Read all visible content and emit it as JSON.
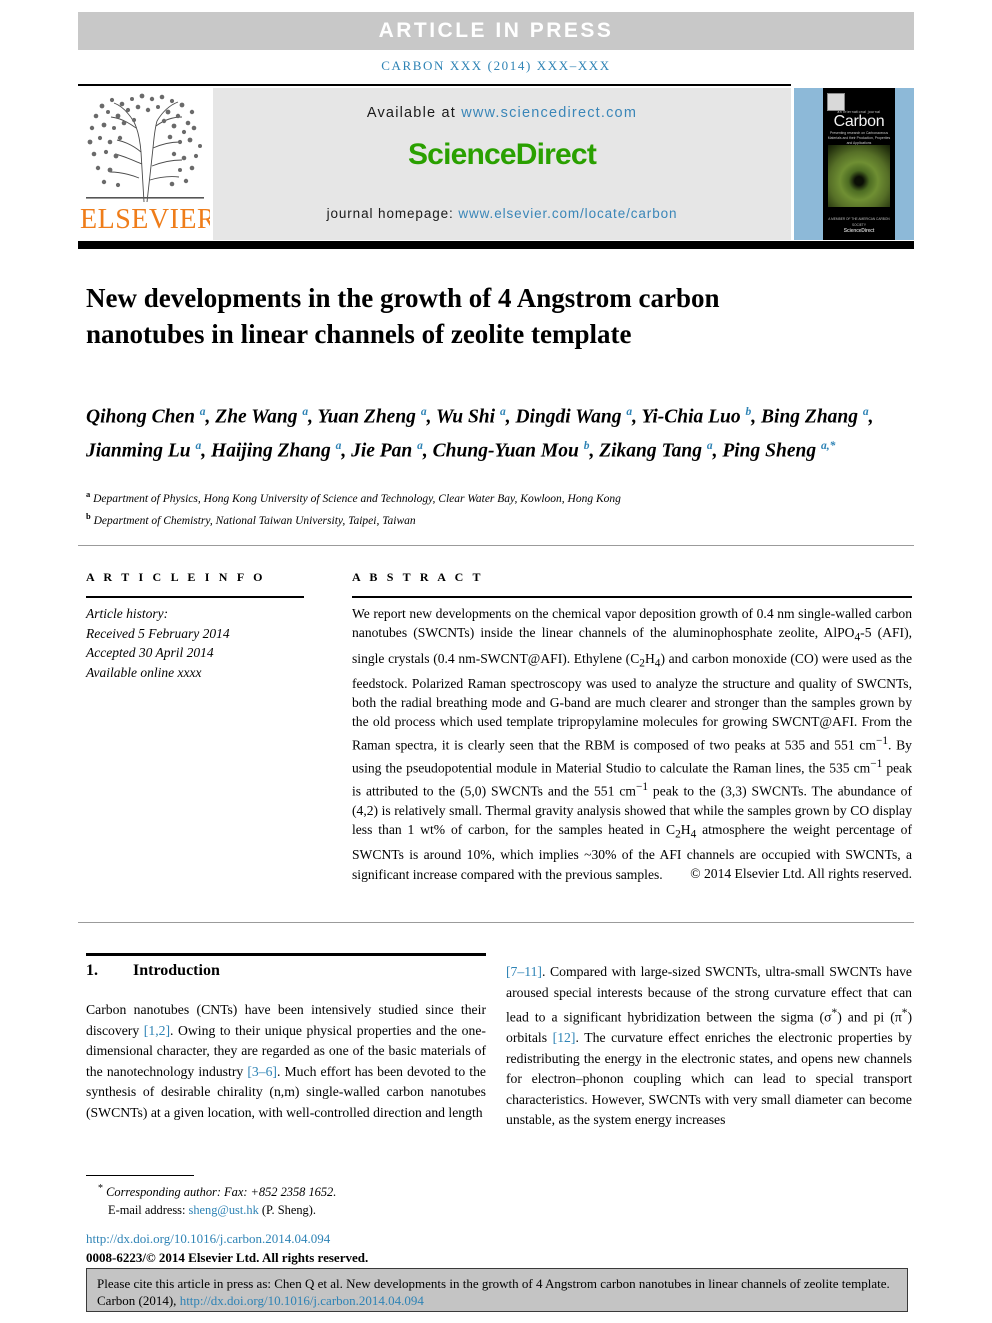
{
  "banner": {
    "article_in_press": "ARTICLE  IN  PRESS",
    "running_head": "CARBON XXX (2014) XXX–XXX"
  },
  "publisher": {
    "logo_word": "ELSEVIER",
    "logo_color": "#ef7d1a"
  },
  "sciencedirect": {
    "available_prefix": "Available at ",
    "available_link": "www.sciencedirect.com",
    "logo": "ScienceDirect",
    "logo_color": "#2aa000",
    "homepage_prefix": "journal homepage: ",
    "homepage_link": "www.elsevier.com/locate/carbon"
  },
  "cover": {
    "supertitle": "an international journal",
    "title": "Carbon",
    "subtitle": "Presenting research on Carbonaceous Materials and their Production, Properties and Applications",
    "footer_small": "A MEMBER OF THE AMERICAN CARBON SOCIETY",
    "footer_brand": "ScienceDirect"
  },
  "article": {
    "title": "New developments in the growth of 4 Angstrom carbon nanotubes in linear channels of zeolite template",
    "authors_html": "Qihong Chen <sup>a</sup>, Zhe Wang <sup>a</sup>, Yuan Zheng <sup>a</sup>, Wu Shi <sup>a</sup>, Dingdi Wang <sup>a</sup>, Yi-Chia Luo <sup>b</sup>, Bing Zhang <sup>a</sup>, Jianming Lu <sup>a</sup>, Haijing Zhang <sup>a</sup>, Jie Pan <sup>a</sup>, Chung-Yuan Mou <sup>b</sup>, Zikang Tang <sup>a</sup>, Ping Sheng <sup>a,*</sup>",
    "affiliation_a": "Department of Physics, Hong Kong University of Science and Technology, Clear Water Bay, Kowloon, Hong Kong",
    "affiliation_b": "Department of Chemistry, National Taiwan University, Taipei, Taiwan",
    "affiliation_a_marker": "a",
    "affiliation_b_marker": "b"
  },
  "article_info": {
    "heading": "A R T I C L E   I N F O",
    "history_label": "Article history:",
    "received": "Received 5 February 2014",
    "accepted": "Accepted 30 April 2014",
    "available_online": "Available online xxxx"
  },
  "abstract": {
    "heading": "A B S T R A C T",
    "text": "We report new developments on the chemical vapor deposition growth of 0.4 nm single-walled carbon nanotubes (SWCNTs) inside the linear channels of the aluminophosphate zeolite, AlPO4-5 (AFI), single crystals (0.4 nm-SWCNT@AFI). Ethylene (C2H4) and carbon monoxide (CO) were used as the feedstock. Polarized Raman spectroscopy was used to analyze the structure and quality of SWCNTs, both the radial breathing mode and G-band are much clearer and stronger than the samples grown by the old process which used template tripropylamine molecules for growing SWCNT@AFI. From the Raman spectra, it is clearly seen that the RBM is composed of two peaks at 535 and 551 cm−1. By using the pseudopotential module in Material Studio to calculate the Raman lines, the 535 cm−1 peak is attributed to the (5,0) SWCNTs and the 551 cm−1 peak to the (3,3) SWCNTs. The abundance of (4,2) is relatively small. Thermal gravity analysis showed that while the samples grown by CO display less than 1 wt% of carbon, for the samples heated in C2H4 atmosphere the weight percentage of SWCNTs is around 10%, which implies ~30% of the AFI channels are occupied with SWCNTs, a significant increase compared with the previous samples.",
    "copyright": "© 2014 Elsevier Ltd. All rights reserved."
  },
  "introduction": {
    "number": "1.",
    "title": "Introduction",
    "left_column": "Carbon nanotubes (CNTs) have been intensively studied since their discovery [1,2]. Owing to their unique physical properties and the one-dimensional character, they are regarded as one of the basic materials of the nanotechnology industry [3–6]. Much effort has been devoted to the synthesis of desirable chirality (n,m) single-walled carbon nanotubes (SWCNTs) at a given location, with well-controlled direction and length",
    "right_column": "[7–11]. Compared with large-sized SWCNTs, ultra-small SWCNTs have aroused special interests because of the strong curvature effect that can lead to a significant hybridization between the sigma (σ*) and pi (π*) orbitals [12]. The curvature effect enriches the electronic properties by redistributing the energy in the electronic states, and opens new channels for electron–phonon coupling which can lead to special transport characteristics. However, SWCNTs with very small diameter can become unstable, as the system energy increases",
    "refs_left": [
      "[1,2]",
      "[3–6]"
    ],
    "refs_right": [
      "[7–11]",
      "[12]"
    ]
  },
  "footnote": {
    "star": "*",
    "corresponding": "Corresponding author: Fax: +852 2358 1652.",
    "email_label": "E-mail address: ",
    "email": "sheng@ust.hk",
    "email_suffix": " (P. Sheng).",
    "doi": "http://dx.doi.org/10.1016/j.carbon.2014.04.094",
    "issn": "0008-6223/© 2014 Elsevier Ltd. All rights reserved."
  },
  "citation_box": {
    "text_prefix": "Please cite this article in press as: Chen Q et al. New developments in the growth of 4 Angstrom carbon nanotubes in linear channels of zeolite template. Carbon (2014), ",
    "link": "http://dx.doi.org/10.1016/j.carbon.2014.04.094"
  },
  "colors": {
    "link": "#2e83b5",
    "banner_bg": "#c8c8c8",
    "sd_green": "#2aa000",
    "elsevier_orange": "#ef7d1a"
  }
}
